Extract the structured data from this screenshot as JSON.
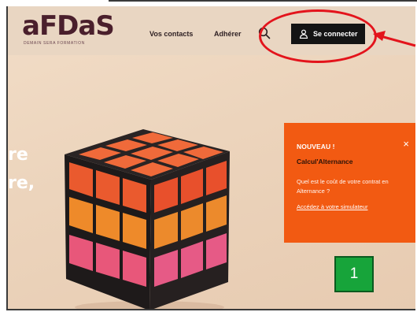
{
  "header": {
    "logo": "aFDaS",
    "tagline": "DEMAIN SERA FORMATION",
    "nav": {
      "contacts": "Vos contacts",
      "adherer": "Adhérer"
    },
    "search_icon": "search-icon",
    "connect_label": "Se connecter",
    "connect_icon": "user-icon"
  },
  "hero": {
    "fragment_1": "re",
    "fragment_2": "re,"
  },
  "promo": {
    "badge": "NOUVEAU !",
    "title": "Calcul'Alternance",
    "text": "Quel est le coût de votre contrat en Alternance ?",
    "link": "Accédez à votre simulateur",
    "close_symbol": "×"
  },
  "annotation": {
    "step_number": "1",
    "highlight_color": "#e3141c",
    "box_color": "#17a43a"
  },
  "colors": {
    "brand": "#4a1f2c",
    "promo_bg": "#f25a12",
    "connect_bg": "#141414"
  }
}
